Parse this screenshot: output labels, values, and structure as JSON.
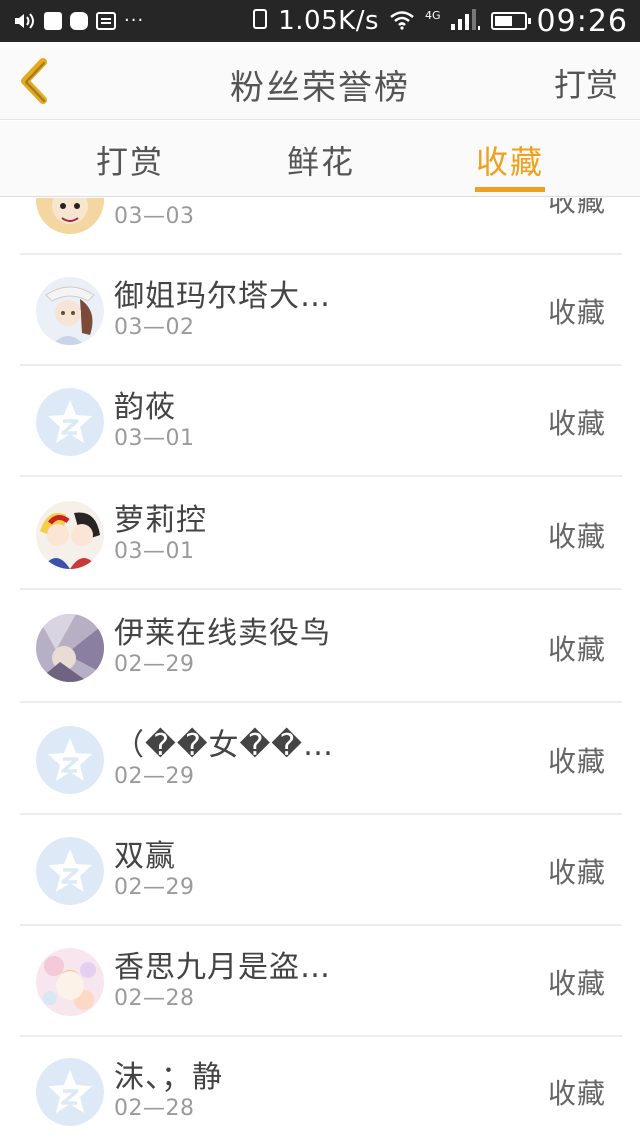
{
  "status_bar": {
    "net_speed": "1.05K/s",
    "network_type": "4G",
    "time": "09:26",
    "icons": [
      "volume-icon",
      "square-icon",
      "rounded-square-icon",
      "message-icon",
      "more-dots-icon",
      "lock-icon",
      "wifi-icon",
      "signal-icon",
      "battery-icon"
    ]
  },
  "header": {
    "title": "粉丝荣誉榜",
    "action": "打赏",
    "back_icon": "chevron-left-icon"
  },
  "tabs": [
    {
      "label": "打赏"
    },
    {
      "label": "鲜花"
    },
    {
      "label": "收藏"
    }
  ],
  "colors": {
    "accent": "#f0a11c",
    "placeholder_avatar": "#dde9f6"
  },
  "list": [
    {
      "name": "",
      "date": "03—03",
      "action": "收藏",
      "avatar": "photo"
    },
    {
      "name": "御姐玛尔塔大…",
      "date": "03—02",
      "action": "收藏",
      "avatar": "photo"
    },
    {
      "name": "韵莜",
      "date": "03—01",
      "action": "收藏",
      "avatar": "default"
    },
    {
      "name": "萝莉控",
      "date": "03—01",
      "action": "收藏",
      "avatar": "photo"
    },
    {
      "name": "伊莱在线卖役鸟",
      "date": "02—29",
      "action": "收藏",
      "avatar": "photo"
    },
    {
      "name": "（��女��…",
      "date": "02—29",
      "action": "收藏",
      "avatar": "default"
    },
    {
      "name": "双赢",
      "date": "02—29",
      "action": "收藏",
      "avatar": "default"
    },
    {
      "name": "香思九月是盗…",
      "date": "02—28",
      "action": "收藏",
      "avatar": "photo"
    },
    {
      "name": "沫、；静",
      "date": "02—28",
      "action": "收藏",
      "avatar": "default"
    }
  ]
}
